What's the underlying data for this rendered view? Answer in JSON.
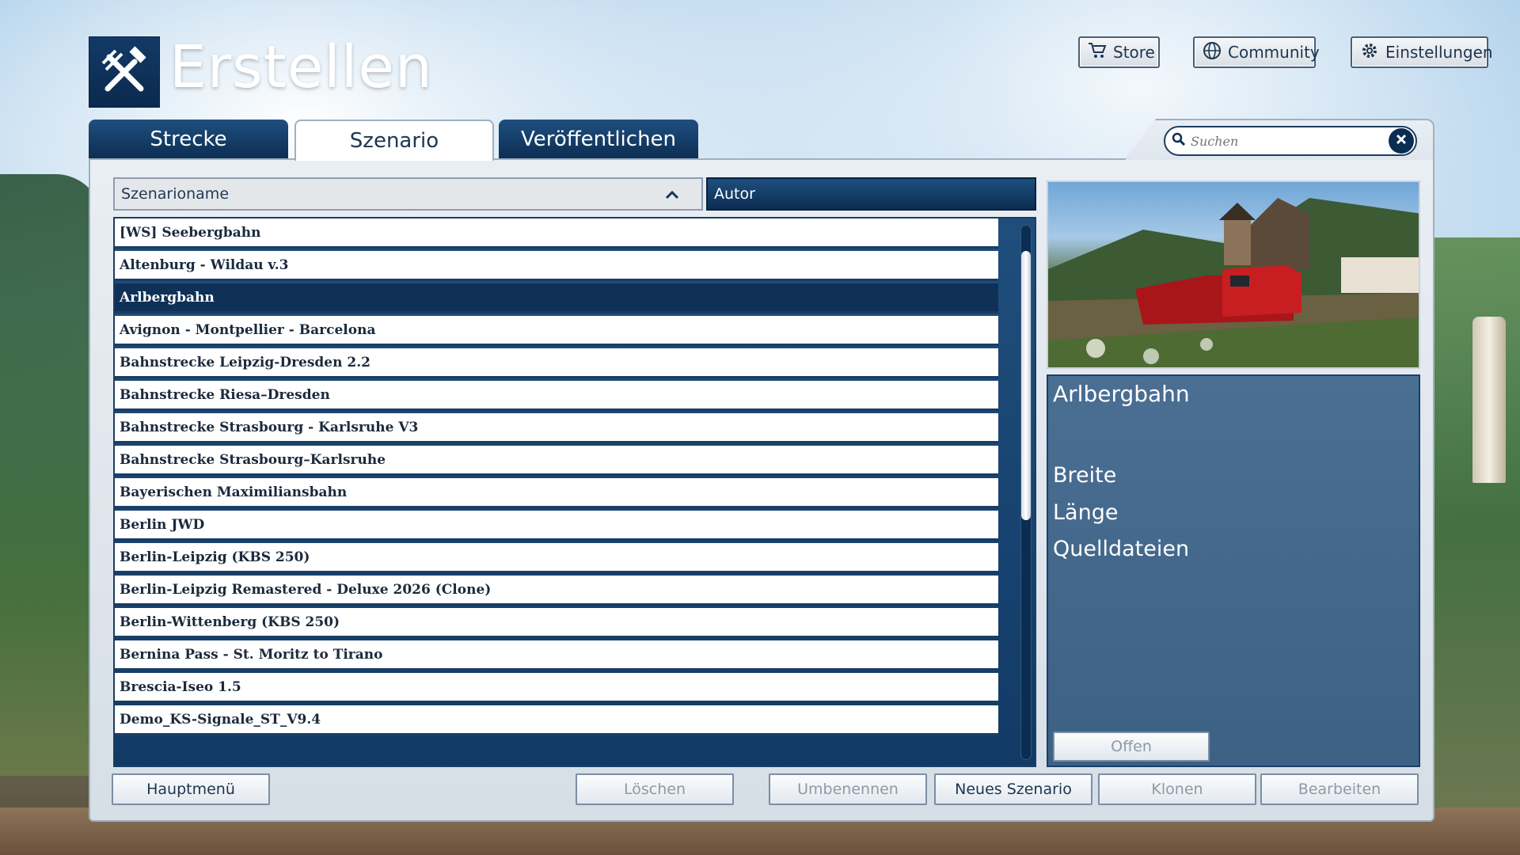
{
  "header": {
    "title": "Erstellen",
    "buttons": [
      {
        "label": "Store",
        "icon": "cart-icon"
      },
      {
        "label": "Community",
        "icon": "globe-icon"
      },
      {
        "label": "Einstellungen",
        "icon": "gear-icon"
      }
    ]
  },
  "tabs": [
    {
      "label": "Strecke",
      "active": false
    },
    {
      "label": "Szenario",
      "active": true
    },
    {
      "label": "Veröffentlichen",
      "active": false
    }
  ],
  "search": {
    "placeholder": "Suchen"
  },
  "list": {
    "columns": {
      "name": "Szenarioname",
      "author": "Autor"
    },
    "sort_direction": "ascending",
    "rows": [
      "[WS] Seebergbahn",
      "Altenburg - Wildau v.3",
      "Arlbergbahn",
      "Avignon - Montpellier - Barcelona",
      "Bahnstrecke Leipzig-Dresden 2.2",
      "Bahnstrecke Riesa–Dresden",
      "Bahnstrecke Strasbourg - Karlsruhe V3",
      "Bahnstrecke Strasbourg–Karlsruhe",
      "Bayerischen Maximiliansbahn",
      "Berlin JWD",
      "Berlin-Leipzig (KBS 250)",
      "Berlin-Leipzig Remastered - Deluxe 2026 (Clone)",
      "Berlin-Wittenberg (KBS 250)",
      "Bernina Pass - St. Moritz to Tirano",
      "Brescia-Iseo 1.5",
      "Demo_KS-Signale_ST_V9.4"
    ],
    "selected_index": 2
  },
  "details": {
    "title": "Arlbergbahn",
    "labels": [
      "Breite",
      "Länge",
      "Quelldateien"
    ],
    "open_button": "Offen"
  },
  "footer": {
    "main_menu": "Hauptmenü",
    "delete": "Löschen",
    "rename": "Umbenennen",
    "new_scenario": "Neues Szenario",
    "clone": "Klonen",
    "edit": "Bearbeiten"
  },
  "colors": {
    "accent": "#0c2d52",
    "selected_row": "#0f3157",
    "details_bg": "#4a6f93"
  }
}
